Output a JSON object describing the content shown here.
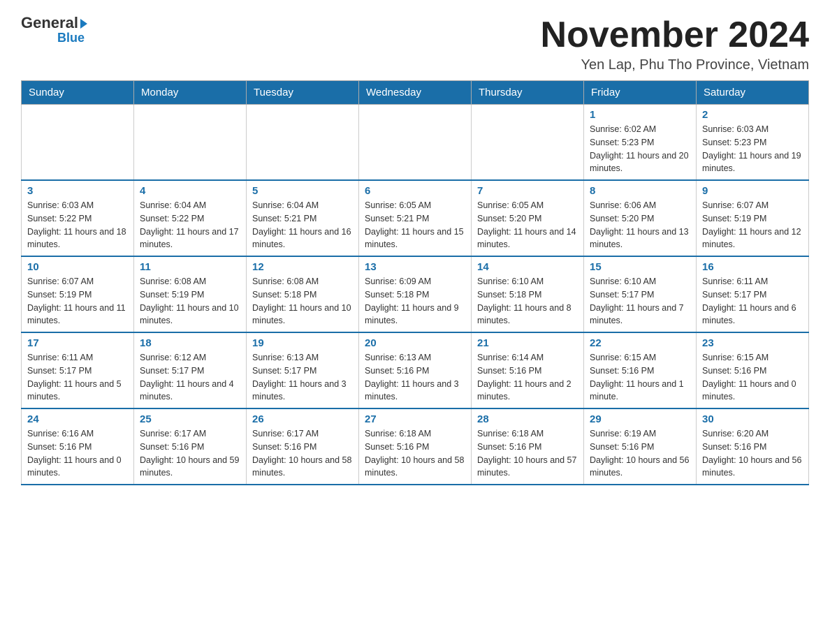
{
  "header": {
    "logo_general": "General",
    "logo_blue": "Blue",
    "month_title": "November 2024",
    "location": "Yen Lap, Phu Tho Province, Vietnam"
  },
  "weekdays": [
    "Sunday",
    "Monday",
    "Tuesday",
    "Wednesday",
    "Thursday",
    "Friday",
    "Saturday"
  ],
  "weeks": [
    [
      {
        "day": "",
        "sunrise": "",
        "sunset": "",
        "daylight": ""
      },
      {
        "day": "",
        "sunrise": "",
        "sunset": "",
        "daylight": ""
      },
      {
        "day": "",
        "sunrise": "",
        "sunset": "",
        "daylight": ""
      },
      {
        "day": "",
        "sunrise": "",
        "sunset": "",
        "daylight": ""
      },
      {
        "day": "",
        "sunrise": "",
        "sunset": "",
        "daylight": ""
      },
      {
        "day": "1",
        "sunrise": "Sunrise: 6:02 AM",
        "sunset": "Sunset: 5:23 PM",
        "daylight": "Daylight: 11 hours and 20 minutes."
      },
      {
        "day": "2",
        "sunrise": "Sunrise: 6:03 AM",
        "sunset": "Sunset: 5:23 PM",
        "daylight": "Daylight: 11 hours and 19 minutes."
      }
    ],
    [
      {
        "day": "3",
        "sunrise": "Sunrise: 6:03 AM",
        "sunset": "Sunset: 5:22 PM",
        "daylight": "Daylight: 11 hours and 18 minutes."
      },
      {
        "day": "4",
        "sunrise": "Sunrise: 6:04 AM",
        "sunset": "Sunset: 5:22 PM",
        "daylight": "Daylight: 11 hours and 17 minutes."
      },
      {
        "day": "5",
        "sunrise": "Sunrise: 6:04 AM",
        "sunset": "Sunset: 5:21 PM",
        "daylight": "Daylight: 11 hours and 16 minutes."
      },
      {
        "day": "6",
        "sunrise": "Sunrise: 6:05 AM",
        "sunset": "Sunset: 5:21 PM",
        "daylight": "Daylight: 11 hours and 15 minutes."
      },
      {
        "day": "7",
        "sunrise": "Sunrise: 6:05 AM",
        "sunset": "Sunset: 5:20 PM",
        "daylight": "Daylight: 11 hours and 14 minutes."
      },
      {
        "day": "8",
        "sunrise": "Sunrise: 6:06 AM",
        "sunset": "Sunset: 5:20 PM",
        "daylight": "Daylight: 11 hours and 13 minutes."
      },
      {
        "day": "9",
        "sunrise": "Sunrise: 6:07 AM",
        "sunset": "Sunset: 5:19 PM",
        "daylight": "Daylight: 11 hours and 12 minutes."
      }
    ],
    [
      {
        "day": "10",
        "sunrise": "Sunrise: 6:07 AM",
        "sunset": "Sunset: 5:19 PM",
        "daylight": "Daylight: 11 hours and 11 minutes."
      },
      {
        "day": "11",
        "sunrise": "Sunrise: 6:08 AM",
        "sunset": "Sunset: 5:19 PM",
        "daylight": "Daylight: 11 hours and 10 minutes."
      },
      {
        "day": "12",
        "sunrise": "Sunrise: 6:08 AM",
        "sunset": "Sunset: 5:18 PM",
        "daylight": "Daylight: 11 hours and 10 minutes."
      },
      {
        "day": "13",
        "sunrise": "Sunrise: 6:09 AM",
        "sunset": "Sunset: 5:18 PM",
        "daylight": "Daylight: 11 hours and 9 minutes."
      },
      {
        "day": "14",
        "sunrise": "Sunrise: 6:10 AM",
        "sunset": "Sunset: 5:18 PM",
        "daylight": "Daylight: 11 hours and 8 minutes."
      },
      {
        "day": "15",
        "sunrise": "Sunrise: 6:10 AM",
        "sunset": "Sunset: 5:17 PM",
        "daylight": "Daylight: 11 hours and 7 minutes."
      },
      {
        "day": "16",
        "sunrise": "Sunrise: 6:11 AM",
        "sunset": "Sunset: 5:17 PM",
        "daylight": "Daylight: 11 hours and 6 minutes."
      }
    ],
    [
      {
        "day": "17",
        "sunrise": "Sunrise: 6:11 AM",
        "sunset": "Sunset: 5:17 PM",
        "daylight": "Daylight: 11 hours and 5 minutes."
      },
      {
        "day": "18",
        "sunrise": "Sunrise: 6:12 AM",
        "sunset": "Sunset: 5:17 PM",
        "daylight": "Daylight: 11 hours and 4 minutes."
      },
      {
        "day": "19",
        "sunrise": "Sunrise: 6:13 AM",
        "sunset": "Sunset: 5:17 PM",
        "daylight": "Daylight: 11 hours and 3 minutes."
      },
      {
        "day": "20",
        "sunrise": "Sunrise: 6:13 AM",
        "sunset": "Sunset: 5:16 PM",
        "daylight": "Daylight: 11 hours and 3 minutes."
      },
      {
        "day": "21",
        "sunrise": "Sunrise: 6:14 AM",
        "sunset": "Sunset: 5:16 PM",
        "daylight": "Daylight: 11 hours and 2 minutes."
      },
      {
        "day": "22",
        "sunrise": "Sunrise: 6:15 AM",
        "sunset": "Sunset: 5:16 PM",
        "daylight": "Daylight: 11 hours and 1 minute."
      },
      {
        "day": "23",
        "sunrise": "Sunrise: 6:15 AM",
        "sunset": "Sunset: 5:16 PM",
        "daylight": "Daylight: 11 hours and 0 minutes."
      }
    ],
    [
      {
        "day": "24",
        "sunrise": "Sunrise: 6:16 AM",
        "sunset": "Sunset: 5:16 PM",
        "daylight": "Daylight: 11 hours and 0 minutes."
      },
      {
        "day": "25",
        "sunrise": "Sunrise: 6:17 AM",
        "sunset": "Sunset: 5:16 PM",
        "daylight": "Daylight: 10 hours and 59 minutes."
      },
      {
        "day": "26",
        "sunrise": "Sunrise: 6:17 AM",
        "sunset": "Sunset: 5:16 PM",
        "daylight": "Daylight: 10 hours and 58 minutes."
      },
      {
        "day": "27",
        "sunrise": "Sunrise: 6:18 AM",
        "sunset": "Sunset: 5:16 PM",
        "daylight": "Daylight: 10 hours and 58 minutes."
      },
      {
        "day": "28",
        "sunrise": "Sunrise: 6:18 AM",
        "sunset": "Sunset: 5:16 PM",
        "daylight": "Daylight: 10 hours and 57 minutes."
      },
      {
        "day": "29",
        "sunrise": "Sunrise: 6:19 AM",
        "sunset": "Sunset: 5:16 PM",
        "daylight": "Daylight: 10 hours and 56 minutes."
      },
      {
        "day": "30",
        "sunrise": "Sunrise: 6:20 AM",
        "sunset": "Sunset: 5:16 PM",
        "daylight": "Daylight: 10 hours and 56 minutes."
      }
    ]
  ]
}
